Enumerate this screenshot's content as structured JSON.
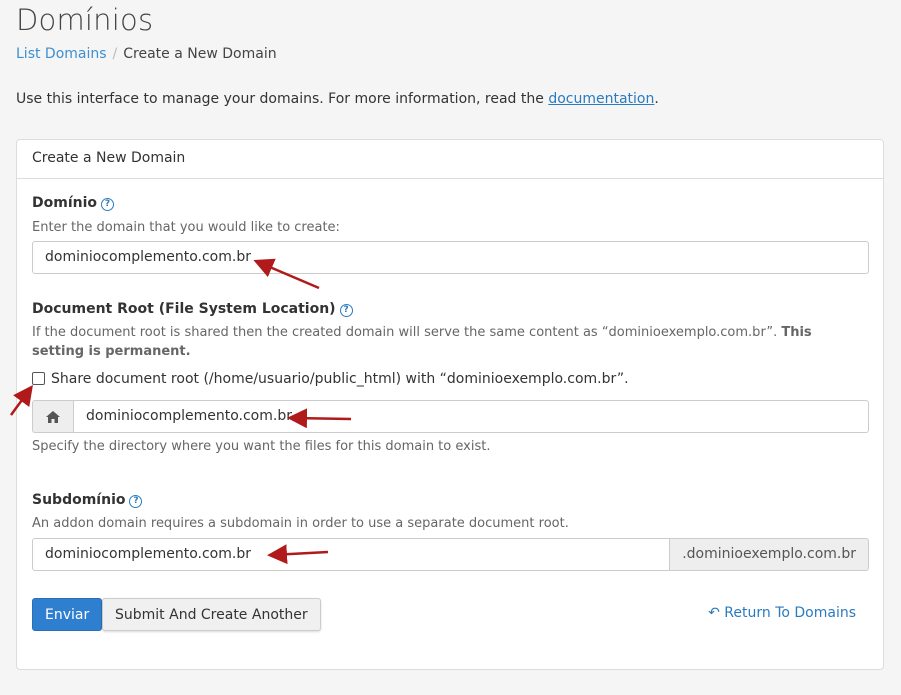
{
  "page": {
    "title": "Domínios",
    "breadcrumb": {
      "parent": "List Domains",
      "current": "Create a New Domain",
      "separator": "/"
    },
    "intro": {
      "text": "Use this interface to manage your domains. For more information, read the ",
      "link": "documentation",
      "suffix": "."
    }
  },
  "panel": {
    "heading": "Create a New Domain",
    "domain": {
      "label": "Domínio",
      "help": "Enter the domain that you would like to create:",
      "value": "dominiocomplemento.com.br"
    },
    "docroot": {
      "label": "Document Root (File System Location)",
      "help": "If the document root is shared then the created domain will serve the same content as “dominioexemplo.com.br”. ",
      "help_bold": "This setting is permanent.",
      "share_label": "Share document root (/home/usuario/public_html) with “dominioexemplo.com.br”.",
      "share_checked": false,
      "value": "dominiocomplemento.com.br",
      "specify_help": "Specify the directory where you want the files for this domain to exist."
    },
    "subdomain": {
      "label": "Subdomínio",
      "help": "An addon domain requires a subdomain in order to use a separate document root.",
      "value": "dominiocomplemento.com.br",
      "suffix": ".dominioexemplo.com.br"
    },
    "buttons": {
      "submit": "Enviar",
      "submit_another": "Submit And Create Another",
      "return": "Return To Domains"
    }
  },
  "colors": {
    "primary": "#2f7fd0",
    "link": "#2a7bbf",
    "annotation_arrow": "#b01a1a"
  }
}
